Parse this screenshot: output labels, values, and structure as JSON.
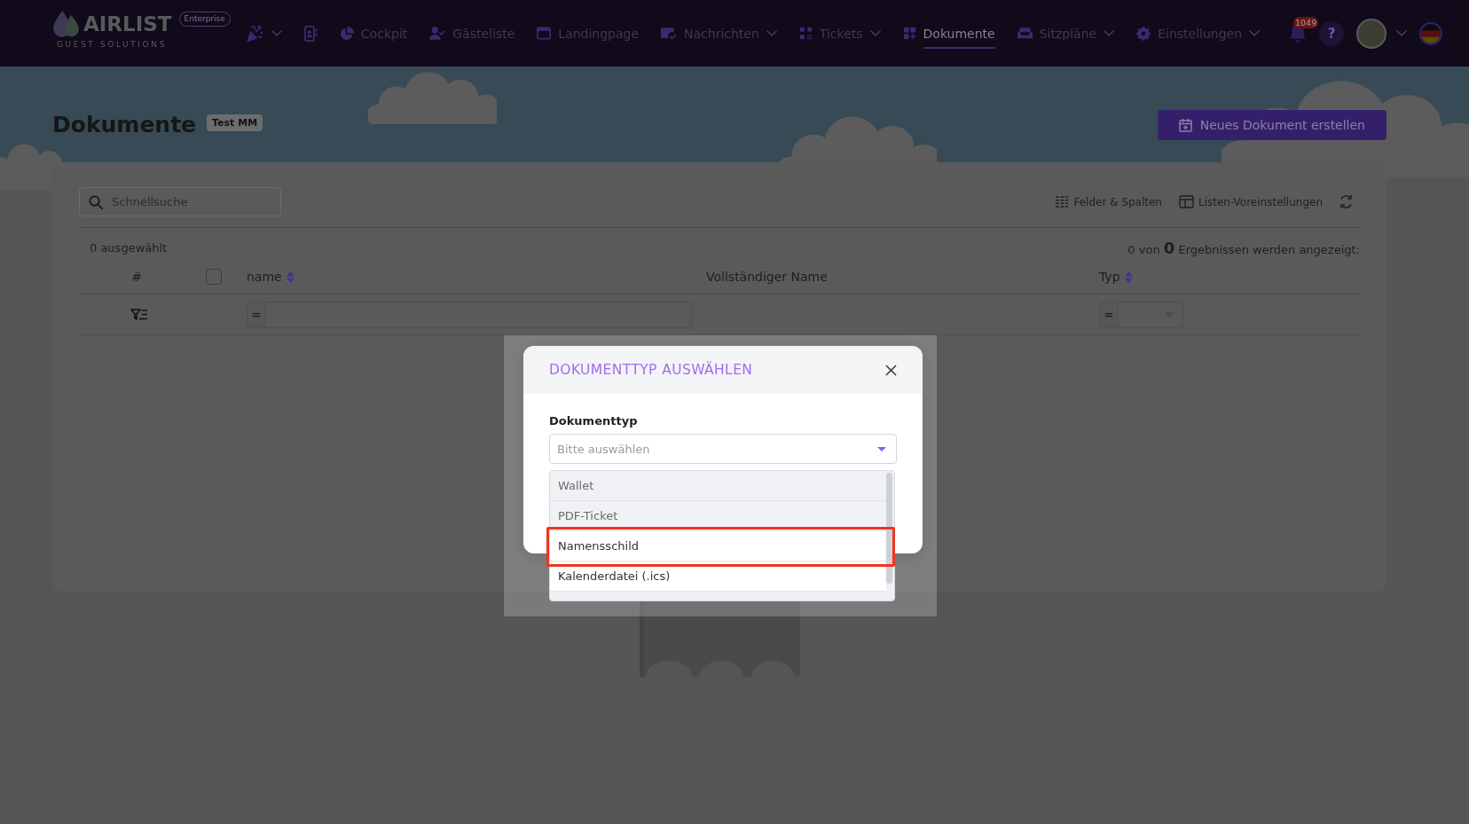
{
  "nav": {
    "logo": {
      "wordmark": "AIRLIST",
      "tagline": "GUEST SOLUTIONS"
    },
    "edition_badge": "Enterprise",
    "items": [
      {
        "kind": "icon",
        "dropdown": true,
        "selected": false
      },
      {
        "kind": "icon",
        "dropdown": false,
        "selected": false
      },
      {
        "kind": "link",
        "label": "Cockpit",
        "dropdown": false,
        "selected": false
      },
      {
        "kind": "link",
        "label": "Gästeliste",
        "dropdown": false,
        "selected": false
      },
      {
        "kind": "link",
        "label": "Landingpage",
        "dropdown": false,
        "selected": false
      },
      {
        "kind": "link",
        "label": "Nachrichten",
        "dropdown": true,
        "selected": false
      },
      {
        "kind": "link",
        "label": "Tickets",
        "dropdown": true,
        "selected": false
      },
      {
        "kind": "link",
        "label": "Dokumente",
        "dropdown": false,
        "selected": true
      },
      {
        "kind": "link",
        "label": "Sitzpläne",
        "dropdown": true,
        "selected": false
      },
      {
        "kind": "link",
        "label": "Einstellungen",
        "dropdown": true,
        "selected": false
      }
    ],
    "notifications": {
      "count": "1049"
    },
    "help": {
      "label": "?"
    },
    "user_menu": {
      "dropdown": true
    }
  },
  "page": {
    "title": "Dokumente",
    "badge": "Test MM",
    "create_button": "Neues Dokument erstellen"
  },
  "list": {
    "search": {
      "placeholder": "Schnellsuche"
    },
    "actions": [
      {
        "label": "Felder & Spalten"
      },
      {
        "label": "Listen-Voreinstellungen"
      }
    ],
    "selected_count": "0 ausgewählt",
    "result_summary": "0 von **0** Ergebnissen werden angezeigt:",
    "columns": [
      {
        "kind": "index",
        "label": "#",
        "filter": {
          "kind": "icon"
        }
      },
      {
        "kind": "checkbox",
        "checked": false
      },
      {
        "kind": "text",
        "label": "name",
        "sortable": true,
        "filter": {
          "kind": "text",
          "operator": "="
        }
      },
      {
        "kind": "text",
        "label": "Vollständiger Name",
        "sortable": false
      },
      {
        "kind": "text",
        "label": "Typ",
        "sortable": true,
        "filter": {
          "kind": "select",
          "operator": "="
        }
      }
    ]
  },
  "modal": {
    "title": "DOKUMENTTYP AUSWÄHLEN",
    "field": {
      "label": "Dokumenttyp",
      "placeholder": "Bitte auswählen"
    },
    "options": [
      {
        "label": "Wallet",
        "disabled": true,
        "highlighted": false
      },
      {
        "label": "PDF-Ticket",
        "disabled": true,
        "highlighted": false
      },
      {
        "label": "Namensschild",
        "disabled": false,
        "highlighted": true
      },
      {
        "label": "Kalenderdatei (.ics)",
        "disabled": false,
        "highlighted": false
      }
    ]
  }
}
